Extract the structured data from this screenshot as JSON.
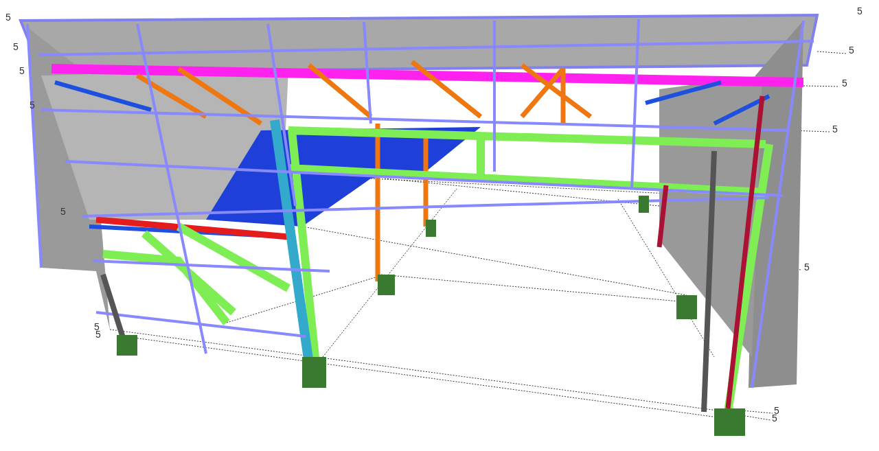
{
  "model_view": {
    "grid_labels": [
      {
        "text": "5"
      },
      {
        "text": "5"
      },
      {
        "text": "5"
      },
      {
        "text": "5"
      },
      {
        "text": "5"
      },
      {
        "text": "5"
      },
      {
        "text": "5"
      },
      {
        "text": "5"
      },
      {
        "text": "5"
      },
      {
        "text": "5"
      },
      {
        "text": "5"
      },
      {
        "text": "5"
      },
      {
        "text": "5"
      },
      {
        "text": "5"
      }
    ]
  }
}
